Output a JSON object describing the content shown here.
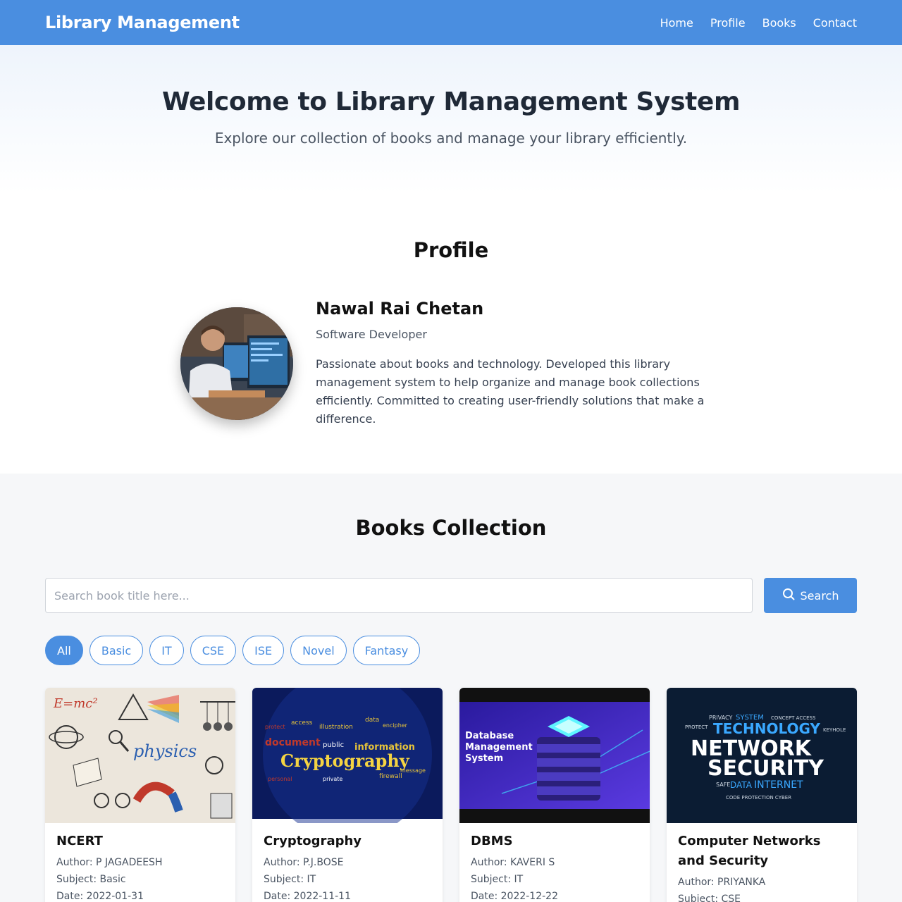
{
  "header": {
    "brand": "Library Management",
    "nav": [
      "Home",
      "Profile",
      "Books",
      "Contact"
    ]
  },
  "hero": {
    "title": "Welcome to Library Management System",
    "subtitle": "Explore our collection of books and manage your library efficiently."
  },
  "profile": {
    "heading": "Profile",
    "name": "Nawal Rai Chetan",
    "role": "Software Developer",
    "bio": "Passionate about books and technology. Developed this library management system to help organize and manage book collections efficiently. Committed to creating user-friendly solutions that make a difference."
  },
  "books": {
    "heading": "Books Collection",
    "search_placeholder": "Search book title here...",
    "search_label": "Search",
    "filters": [
      "All",
      "Basic",
      "IT",
      "CSE",
      "ISE",
      "Novel",
      "Fantasy"
    ],
    "active_filter": "All",
    "cards": [
      {
        "title": "NCERT",
        "author": "Author: P JAGADEESH",
        "subject": "Subject: Basic",
        "date": "Date: 2022-01-31",
        "cover_text": "physics"
      },
      {
        "title": "Cryptography",
        "author": "Author: P.J.BOSE",
        "subject": "Subject: IT",
        "date": "Date: 2022-11-11",
        "cover_text": "Cryptography"
      },
      {
        "title": "DBMS",
        "author": "Author: KAVERI S",
        "subject": "Subject: IT",
        "date": "Date: 2022-12-22",
        "cover_text": "Database Management System"
      },
      {
        "title": "Computer Networks and Security",
        "author": "Author: PRIYANKA",
        "subject": "Subject: CSE",
        "date": "",
        "cover_text": "NETWORK SECURITY"
      }
    ]
  },
  "colors": {
    "primary": "#4a8ee0",
    "section_bg": "#f6f7f9"
  }
}
